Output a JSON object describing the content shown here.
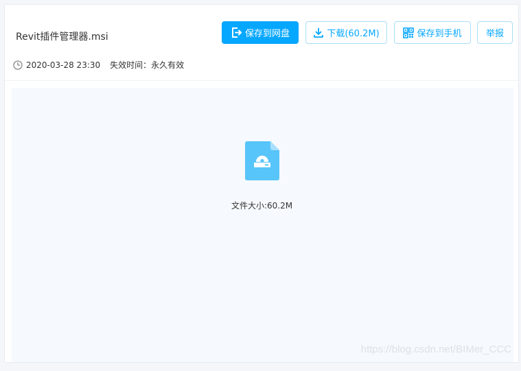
{
  "file": {
    "name": "Revit插件管理器.msi",
    "date": "2020-03-28 23:30",
    "expire": "失效时间：永久有效",
    "size_label": "文件大小:60.2M"
  },
  "actions": {
    "save_to_disk": "保存到网盘",
    "download": "下载(60.2M)",
    "save_to_phone": "保存到手机",
    "report": "举报"
  },
  "watermark": "https://blog.csdn.net/BIMer_CCC",
  "icons": {
    "save": "save-to-disk-icon",
    "download": "download-icon",
    "phone": "qrcode-icon",
    "clock": "clock-icon",
    "file": "installer-file-icon"
  },
  "colors": {
    "accent": "#06a7ff",
    "accent_border": "#a9ddf8",
    "file_icon": "#58c5fa",
    "preview_bg": "#f6f9fd"
  }
}
